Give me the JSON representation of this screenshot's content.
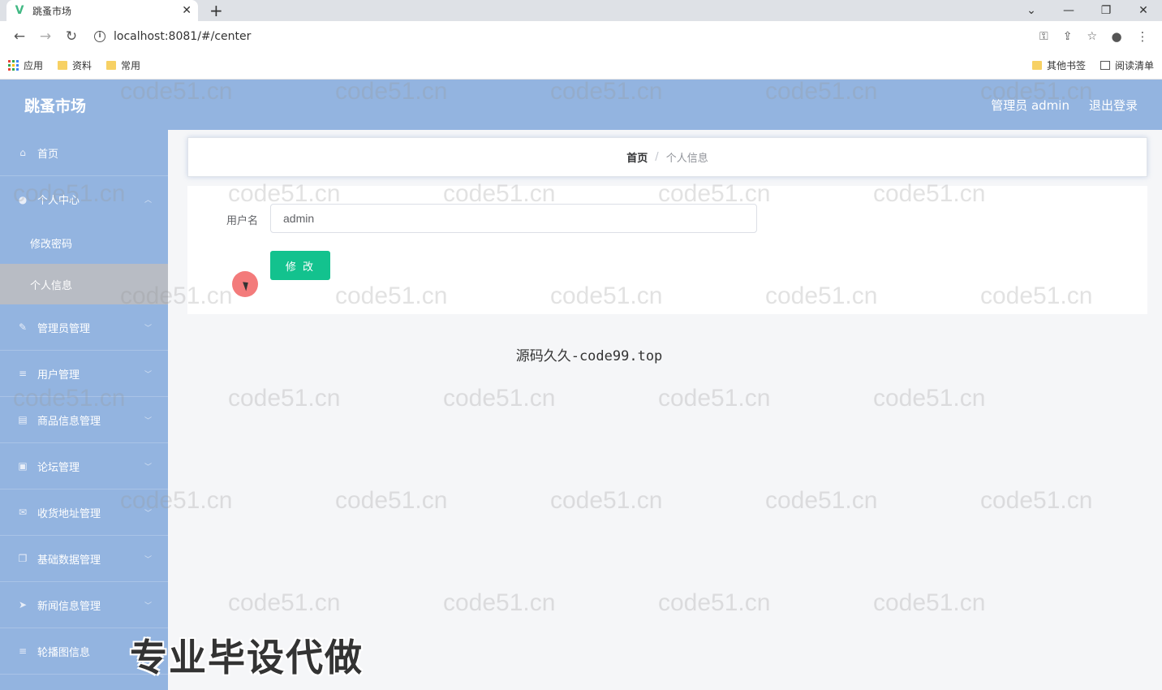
{
  "browser": {
    "tab_title": "跳蚤市场",
    "url": "localhost:8081/#/center",
    "bookmarks": [
      "应用",
      "资料",
      "常用"
    ],
    "bookmarks_right": [
      "其他书签",
      "阅读清单"
    ]
  },
  "header": {
    "title": "跳蚤市场",
    "user_label": "管理员 admin",
    "logout_label": "退出登录"
  },
  "sidebar": {
    "items": [
      {
        "label": "首页",
        "icon": "home-icon"
      },
      {
        "label": "个人中心",
        "icon": "user-icon"
      },
      {
        "label": "管理员管理",
        "icon": "pen-icon"
      },
      {
        "label": "用户管理",
        "icon": "menu-icon"
      },
      {
        "label": "商品信息管理",
        "icon": "doc-icon"
      },
      {
        "label": "论坛管理",
        "icon": "chart-icon"
      },
      {
        "label": "收货地址管理",
        "icon": "mail-icon"
      },
      {
        "label": "基础数据管理",
        "icon": "copy-icon"
      },
      {
        "label": "新闻信息管理",
        "icon": "send-icon"
      },
      {
        "label": "轮播图信息",
        "icon": "menu-icon"
      }
    ],
    "sub_items": [
      "修改密码",
      "个人信息"
    ]
  },
  "breadcrumb": {
    "home": "首页",
    "separator": "/",
    "current": "个人信息"
  },
  "form": {
    "username_label": "用户名",
    "username_value": "admin",
    "submit_label": "修 改"
  },
  "footer": {
    "text": "源码久久-code99.top"
  },
  "watermark": {
    "text": "code51.cn",
    "banner": "专业毕设代做"
  }
}
